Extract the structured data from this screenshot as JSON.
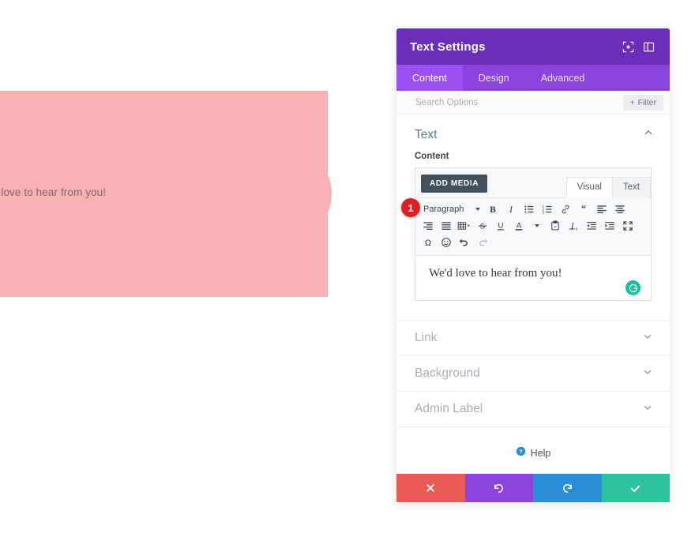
{
  "preview": {
    "text": "We'd love to hear from you!",
    "section_bg_color": "#f9b0b3"
  },
  "modal": {
    "title": "Text Settings",
    "header_icons": [
      {
        "name": "focus-mode-icon",
        "label": "Focus"
      },
      {
        "name": "layout-panel-icon",
        "label": "Panel layout"
      }
    ],
    "tabs": [
      {
        "label": "Content",
        "active": true
      },
      {
        "label": "Design",
        "active": false
      },
      {
        "label": "Advanced",
        "active": false
      }
    ],
    "search": {
      "placeholder": "Search Options",
      "value": ""
    },
    "filter_button": {
      "label": "Filter",
      "icon": "plus-icon"
    },
    "open_section": {
      "title": "Text",
      "field_label": "Content",
      "toggle_icon": "chevron-up-icon"
    },
    "editor": {
      "add_media_label": "ADD MEDIA",
      "mode_tabs": [
        {
          "label": "Visual",
          "active": true
        },
        {
          "label": "Text",
          "active": false
        }
      ],
      "format_select": "Paragraph",
      "toolbar_row1": [
        "bold-icon",
        "italic-icon",
        "bulleted-list-icon",
        "numbered-list-icon",
        "link-icon",
        "blockquote-icon",
        "align-left-icon",
        "align-center-icon"
      ],
      "toolbar_row2": [
        "align-right-icon",
        "align-justify-icon",
        "table-icon",
        "strikethrough-icon",
        "underline-icon",
        "text-color-icon",
        "paste-as-text-icon",
        "clear-formatting-icon",
        "outdent-icon",
        "indent-icon",
        "fullscreen-icon"
      ],
      "toolbar_row3": [
        "special-character-icon",
        "emoji-icon",
        "undo-icon",
        "redo-icon"
      ],
      "content": "We'd love to hear from you!",
      "grammarly_icon": "grammarly-icon"
    },
    "callout_badge": "1",
    "collapsed_sections": [
      {
        "label": "Link",
        "icon": "chevron-down-icon"
      },
      {
        "label": "Background",
        "icon": "chevron-down-icon"
      },
      {
        "label": "Admin Label",
        "icon": "chevron-down-icon"
      }
    ],
    "help": {
      "label": "Help",
      "icon": "help-circle-icon"
    },
    "footer_buttons": [
      {
        "name": "cancel",
        "icon": "close-x-icon",
        "color": "#ea5a57"
      },
      {
        "name": "undo",
        "icon": "undo-arrow-icon",
        "color": "#8a43dd"
      },
      {
        "name": "redo",
        "icon": "redo-arrow-icon",
        "color": "#2a8ed6"
      },
      {
        "name": "save",
        "icon": "checkmark-icon",
        "color": "#2ec4a0"
      }
    ]
  }
}
